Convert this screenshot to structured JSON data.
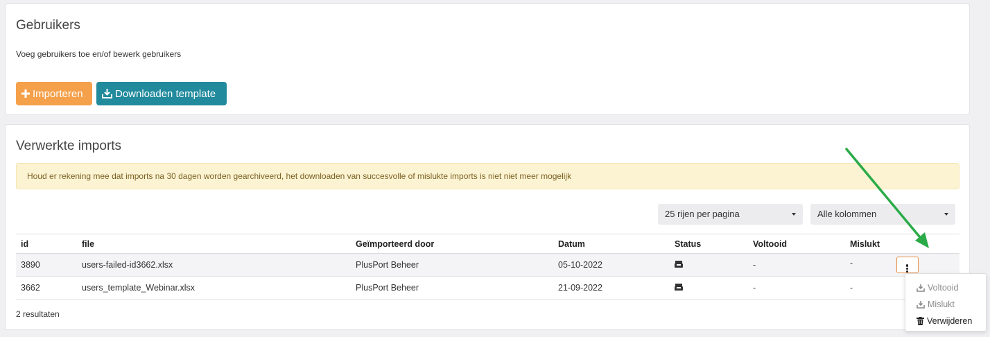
{
  "users_card": {
    "title": "Gebruikers",
    "subtitle": "Voeg gebruikers toe en/of bewerk gebruikers",
    "import_button": "Importeren",
    "download_button": "Downloaden  template"
  },
  "imports_card": {
    "title": "Verwerkte imports",
    "alert": "Houd er rekening mee dat imports na 30 dagen worden gearchiveerd, het downloaden van succesvolle of mislukte imports is niet niet meer mogelijk",
    "rows_select": "25 rijen per pagina",
    "columns_select": "Alle kolommen",
    "columns": [
      "id",
      "file",
      "Geïmporteerd door",
      "Datum",
      "Status",
      "Voltooid",
      "Mislukt"
    ],
    "rows": [
      {
        "id": "3890",
        "file": "users-failed-id3662.xlsx",
        "by": "PlusPort Beheer",
        "date": "05-10-2022",
        "status_icon": "inbox-icon",
        "done": "-",
        "failed": "-"
      },
      {
        "id": "3662",
        "file": "users_template_Webinar.xlsx",
        "by": "PlusPort Beheer",
        "date": "21-09-2022",
        "status_icon": "inbox-icon",
        "done": "-",
        "failed": "-"
      }
    ],
    "results": "2 resultaten"
  },
  "dropdown_menu": {
    "items": [
      {
        "label": "Voltooid",
        "icon": "download-icon",
        "disabled": true
      },
      {
        "label": "Mislukt",
        "icon": "download-icon",
        "disabled": true
      },
      {
        "label": "Verwijderen",
        "icon": "trash-icon",
        "disabled": false
      }
    ]
  },
  "colors": {
    "orange": "#f5a04a",
    "teal": "#218a9c",
    "alert_bg": "#fcf3d2",
    "annotation_arrow": "#2bab48"
  }
}
